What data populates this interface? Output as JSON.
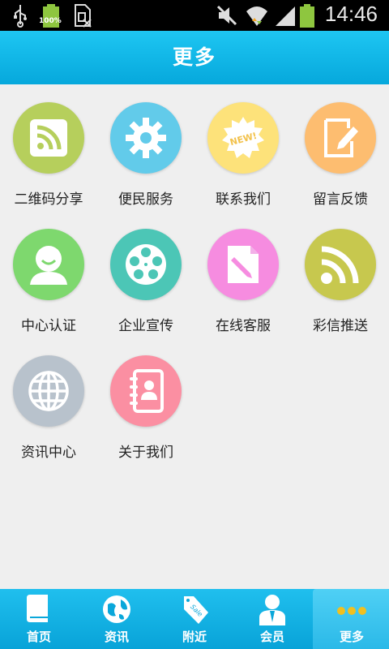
{
  "status_bar": {
    "time": "14:46",
    "battery_label": "100%",
    "icons": [
      "usb-icon",
      "battery-full-icon",
      "sim-icon",
      "mute-icon",
      "wifi-icon",
      "signal-icon",
      "battery-icon"
    ]
  },
  "header": {
    "title": "更多"
  },
  "grid": {
    "items": [
      {
        "label": "二维码分享",
        "icon": "rss-square-icon",
        "color": "#b6cf5c"
      },
      {
        "label": "便民服务",
        "icon": "gear-icon",
        "color": "#62cbea"
      },
      {
        "label": "联系我们",
        "icon": "new-badge-icon",
        "color": "#fde27a"
      },
      {
        "label": "留言反馈",
        "icon": "edit-note-icon",
        "color": "#fdbd70"
      },
      {
        "label": "中心认证",
        "icon": "user-icon",
        "color": "#7ed86e"
      },
      {
        "label": "企业宣传",
        "icon": "film-reel-icon",
        "color": "#4cc6b6"
      },
      {
        "label": "在线客服",
        "icon": "document-pen-icon",
        "color": "#f68ce0"
      },
      {
        "label": "彩信推送",
        "icon": "rss-icon",
        "color": "#c7c84e"
      },
      {
        "label": "资讯中心",
        "icon": "globe-icon",
        "color": "#b8c2cc"
      },
      {
        "label": "关于我们",
        "icon": "contact-book-icon",
        "color": "#fb8fa2"
      }
    ]
  },
  "tab_bar": {
    "tabs": [
      {
        "label": "首页",
        "icon": "book-icon"
      },
      {
        "label": "资讯",
        "icon": "globe-icon"
      },
      {
        "label": "附近",
        "icon": "sale-tag-icon"
      },
      {
        "label": "会员",
        "icon": "member-icon"
      },
      {
        "label": "更多",
        "icon": "more-dots-icon",
        "active": true
      }
    ]
  }
}
